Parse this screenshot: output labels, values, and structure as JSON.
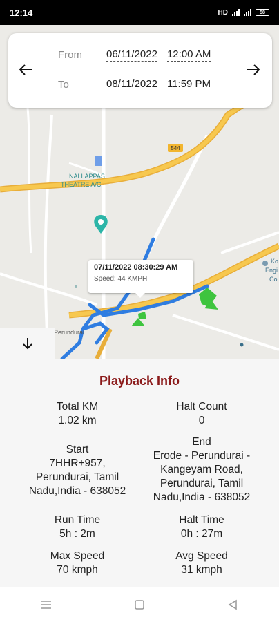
{
  "status_bar": {
    "time": "12:14",
    "network": "HD",
    "battery": "58"
  },
  "date_range": {
    "from_label": "From",
    "from_date": "06/11/2022",
    "from_time": "12:00 AM",
    "to_label": "To",
    "to_date": "08/11/2022",
    "to_time": "11:59 PM"
  },
  "map": {
    "labels": {
      "theatre": "NALLAPPAS THEATRE A/C",
      "road_shield": "544",
      "town": "Perundurai",
      "right_edge_1": "Ko",
      "right_edge_2": "Engi",
      "right_edge_3": "Co"
    },
    "tooltip": {
      "time": "07/11/2022 08:30:29 AM",
      "speed_label": "Speed:",
      "speed_value": "44",
      "speed_unit": "KMPH"
    },
    "colors": {
      "route": "#2f7de1",
      "highway": "#f7c34b",
      "marker": "#3ec43e"
    }
  },
  "playback_info": {
    "title": "Playback Info",
    "total_km": {
      "label": "Total KM",
      "value": "1.02 km"
    },
    "halt_count": {
      "label": "Halt Count",
      "value": "0"
    },
    "start": {
      "label": "Start",
      "line1": "7HHR+957,",
      "line2": "Perundurai, Tamil",
      "line3": "Nadu,India - 638052"
    },
    "end": {
      "label": "End",
      "line1": "Erode - Perundurai -",
      "line2": "Kangeyam Road,",
      "line3": "Perundurai, Tamil",
      "line4": "Nadu,India - 638052"
    },
    "run_time": {
      "label": "Run Time",
      "value": "5h : 2m"
    },
    "halt_time": {
      "label": "Halt Time",
      "value": "0h : 27m"
    },
    "max_speed": {
      "label": "Max Speed",
      "value": "70 kmph"
    },
    "avg_speed": {
      "label": "Avg Speed",
      "value": "31 kmph"
    }
  },
  "nav_bar": {
    "icons": [
      "menu-icon",
      "home-square-icon",
      "back-triangle-icon"
    ]
  }
}
